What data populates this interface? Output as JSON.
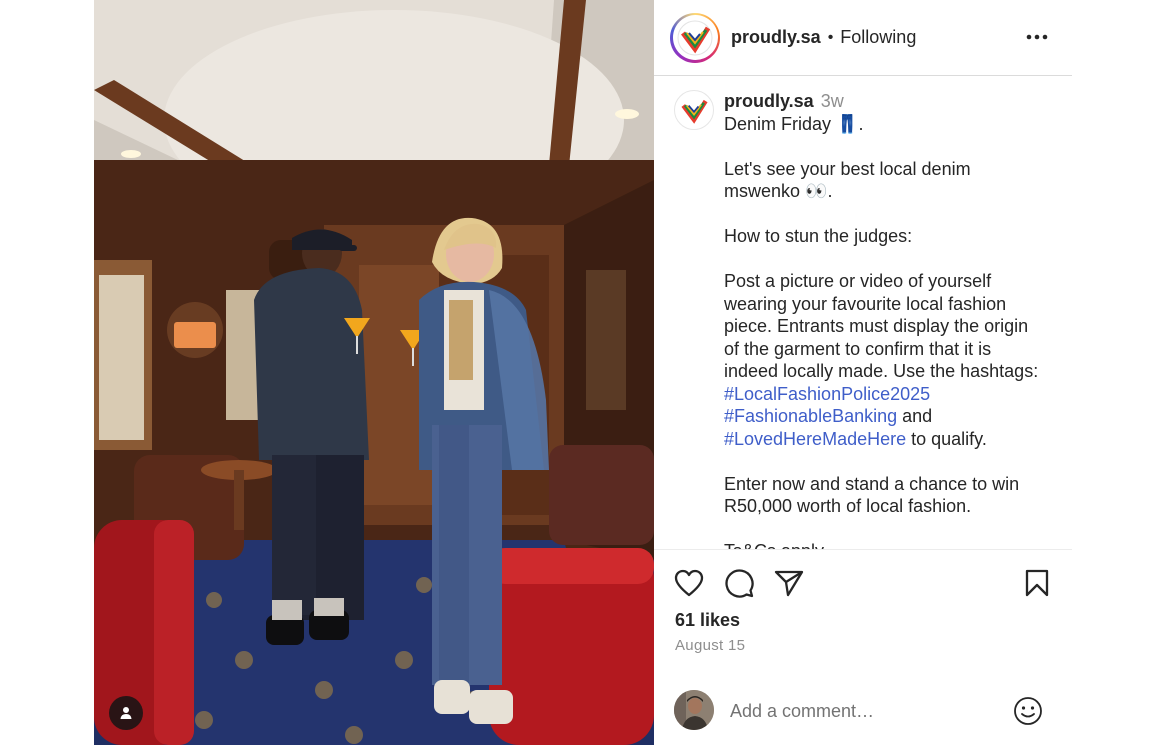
{
  "post": {
    "author": "proudly.sa",
    "separator": "•",
    "follow_status": "Following",
    "age": "3w"
  },
  "caption": {
    "lines": [
      "Denim Friday 👖.",
      "",
      "Let's see your best local denim",
      "mswenko 👀.",
      "",
      "How to stun the judges:",
      "",
      "Post a picture or video of yourself",
      "wearing your favourite local fashion",
      "piece. Entrants must display the origin",
      "of the garment to confirm that it is",
      "indeed locally made. Use the hashtags:"
    ],
    "hashtags": [
      "#LocalFashionPolice2025",
      "#FashionableBanking",
      "#LovedHereMadeHere"
    ],
    "and_word": "and",
    "qualify_suffix": "to qualify.",
    "closing_lines": [
      "Enter now and stand a chance to win",
      "R50,000 worth of local fashion.",
      "",
      "Ts&Cs apply."
    ]
  },
  "engagement": {
    "likes": "61 likes",
    "date": "August 15"
  },
  "comment": {
    "placeholder": "Add a comment…"
  },
  "icons": {
    "header_more": "more-options-icon",
    "like": "heart-icon",
    "comment": "comment-bubble-icon",
    "share": "paper-plane-icon",
    "save": "bookmark-icon",
    "emoji": "smiley-icon",
    "tag": "user-tag-icon",
    "logo": "proudly-sa-logo"
  },
  "colors": {
    "hashtag": "#3f5ec9",
    "muted": "#8e8e8e",
    "text": "#262626",
    "divider": "#dbdbdb"
  }
}
